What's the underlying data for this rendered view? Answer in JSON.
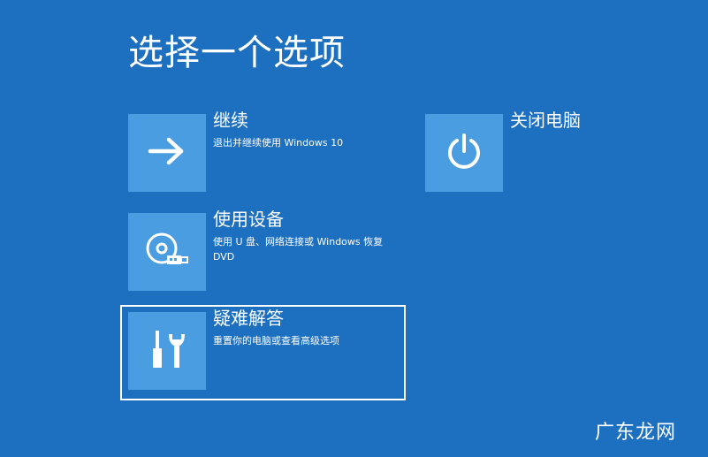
{
  "screen": {
    "title": "选择一个选项"
  },
  "options": {
    "continue": {
      "label": "继续",
      "description": "退出并继续使用 Windows 10",
      "icon": "arrow-right-icon"
    },
    "use_device": {
      "label": "使用设备",
      "description": "使用 U 盘、网络连接或 Windows 恢复 DVD",
      "icon": "disc-drive-icon"
    },
    "troubleshoot": {
      "label": "疑难解答",
      "description": "重置你的电脑或查看高级选项",
      "icon": "tools-icon"
    },
    "shutdown": {
      "label": "关闭电脑",
      "icon": "power-icon"
    }
  },
  "watermark": {
    "text": "广东龙网"
  },
  "colors": {
    "background": "#1d6fc0",
    "tile": "#4a9de0",
    "text": "#ffffff"
  }
}
